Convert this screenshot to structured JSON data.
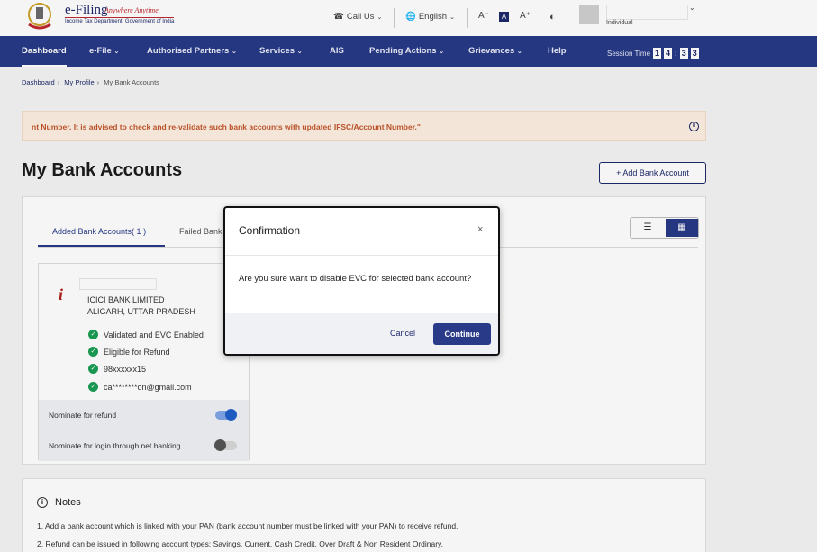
{
  "header": {
    "logo_title": "e-Filing",
    "logo_tagline": "Anywhere Anytime",
    "logo_subtitle": "Income Tax Department, Government of India",
    "call_us": "Call Us",
    "language": "English",
    "font_small": "A⁻",
    "font_default": "A",
    "font_large": "A⁺",
    "user_role": "Individual"
  },
  "nav": {
    "items": [
      "Dashboard",
      "e-File",
      "Authorised Partners",
      "Services",
      "AIS",
      "Pending Actions",
      "Grievances",
      "Help"
    ],
    "session_label": "Session Time",
    "session_digits": [
      "1",
      "4",
      "3",
      "3"
    ]
  },
  "breadcrumb": {
    "items": [
      "Dashboard",
      "My Profile",
      "My Bank Accounts"
    ]
  },
  "alert": {
    "text": "nt Number. It is advised to check and re-validate such bank accounts with updated IFSC/Account Number.\""
  },
  "page": {
    "title": "My Bank Accounts",
    "add_button": "+ Add Bank Account"
  },
  "tabs": {
    "added": "Added Bank Accounts( 1 )",
    "failed": "Failed Bank"
  },
  "bank": {
    "name": "ICICI BANK LIMITED",
    "location": "ALIGARH, UTTAR PRADESH",
    "features": [
      "Validated and EVC Enabled",
      "Eligible for Refund",
      "98xxxxxx15",
      "ca********on@gmail.com"
    ],
    "nominate_refund": "Nominate for refund",
    "nominate_login": "Nominate for login through net banking"
  },
  "notes": {
    "title": "Notes",
    "items": [
      "1. Add a bank account which is linked with your PAN (bank account number must be linked with your PAN) to receive refund.",
      "2. Refund can be issued in following account types: Savings, Current, Cash Credit, Over Draft & Non Resident Ordinary."
    ]
  },
  "modal": {
    "title": "Confirmation",
    "close": "×",
    "body": "Are you sure want to disable EVC for selected bank account?",
    "cancel": "Cancel",
    "continue": "Continue"
  }
}
